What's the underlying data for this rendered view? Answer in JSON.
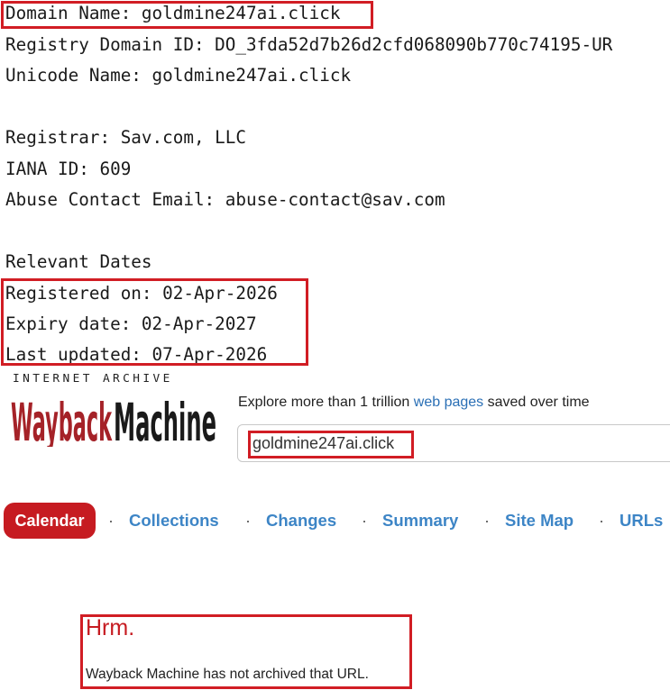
{
  "whois": {
    "domain_name": "Domain Name: goldmine247ai.click",
    "registry_id": "Registry Domain ID: DO_3fda52d7b26d2cfd068090b770c74195-UR",
    "unicode_name": "Unicode Name: goldmine247ai.click",
    "registrar": "Registrar: Sav.com, LLC",
    "iana_id": "IANA ID: 609",
    "abuse_email": "Abuse Contact Email: abuse-contact@sav.com",
    "dates_heading": "Relevant Dates",
    "registered": "Registered on: 02-Apr-2026",
    "expiry": "Expiry date: 02-Apr-2027",
    "updated": "Last updated: 07-Apr-2026"
  },
  "wayback": {
    "ia_label": "INTERNET ARCHIVE",
    "logo_text": "WaybackMachine",
    "explore_prefix": "Explore more than 1 trillion ",
    "explore_link": "web pages",
    "explore_suffix": " saved over time",
    "search_value": "goldmine247ai.click",
    "nav": {
      "calendar": "Calendar",
      "collections": "Collections",
      "changes": "Changes",
      "summary": "Summary",
      "sitemap": "Site Map",
      "urls": "URLs",
      "separator": "·"
    },
    "error_title": "Hrm.",
    "error_message": "Wayback Machine has not archived that URL."
  },
  "colors": {
    "highlight_red": "#d11d24",
    "wayback_red": "#c61b21",
    "link_blue": "#3d85c6"
  }
}
